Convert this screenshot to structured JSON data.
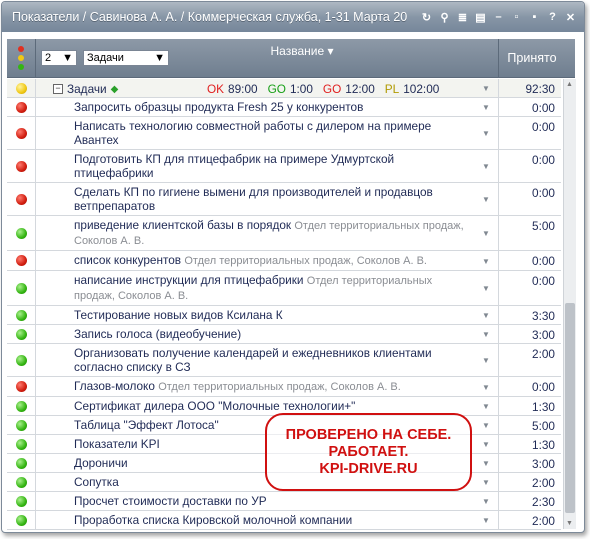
{
  "window": {
    "title": "Показатели / Савинова А. А. / Коммерческая служба, 1-31 Марта 20",
    "icons": [
      "refresh-icon",
      "search-icon",
      "list-icon",
      "export-icon",
      "minimize-icon",
      "restore-icon",
      "close-icon",
      "help-icon",
      "close-window-icon"
    ]
  },
  "header": {
    "level_value": "2",
    "view_value": "Задачи",
    "name_label": "Название",
    "accepted_label": "Принято"
  },
  "group": {
    "label": "Задачи",
    "ok_label": "OK",
    "ok_value": "89:00",
    "go1_label": "GO",
    "go1_value": "1:00",
    "go2_label": "GO",
    "go2_value": "12:00",
    "pl_label": "PL",
    "pl_value": "102:00",
    "accepted": "92:30"
  },
  "tasks": [
    {
      "status": "red",
      "name": "Запросить образцы продукта Fresh 25 у конкурентов",
      "dept": "",
      "value": "0:00"
    },
    {
      "status": "red",
      "name": "Написать технологию совместной работы с дилером на примере Авантех",
      "dept": "",
      "value": "0:00"
    },
    {
      "status": "red",
      "name": "Подготовить КП для птицефабрик на примере Удмуртской птицефабрики",
      "dept": "",
      "value": "0:00"
    },
    {
      "status": "red",
      "name": "Сделать КП по гигиене вымени для производителей и продавцов ветпрепаратов",
      "dept": "",
      "value": "0:00"
    },
    {
      "status": "green",
      "name": "приведение клиентской базы в порядок",
      "dept": "Отдел территориальных продаж, Соколов А. В.",
      "value": "5:00"
    },
    {
      "status": "red",
      "name": "список конкурентов",
      "dept": "Отдел территориальных продаж, Соколов А. В.",
      "value": "0:00"
    },
    {
      "status": "green",
      "name": "написание инструкции для птицефабрики",
      "dept": "Отдел территориальных продаж, Соколов А. В.",
      "value": "0:00"
    },
    {
      "status": "green",
      "name": "Тестирование новых видов Ксилана К",
      "dept": "",
      "value": "3:30"
    },
    {
      "status": "green",
      "name": "Запись голоса (видеобучение)",
      "dept": "",
      "value": "3:00"
    },
    {
      "status": "green",
      "name": "Организовать получение календарей и ежедневников клиентами согласно списку в СЗ",
      "dept": "",
      "value": "2:00"
    },
    {
      "status": "red",
      "name": "Глазов-молоко",
      "dept": "Отдел территориальных продаж, Соколов А. В.",
      "value": "0:00"
    },
    {
      "status": "green",
      "name": "Сертификат дилера ООО \"Молочные технологии+\"",
      "dept": "",
      "value": "1:30"
    },
    {
      "status": "green",
      "name": "Таблица \"Эффект Лотоса\"",
      "dept": "",
      "value": "5:00"
    },
    {
      "status": "green",
      "name": "Показатели KPI",
      "dept": "",
      "value": "1:30"
    },
    {
      "status": "green",
      "name": "Дороничи",
      "dept": "",
      "value": "3:00"
    },
    {
      "status": "green",
      "name": "Сопутка",
      "dept": "",
      "value": "2:00"
    },
    {
      "status": "green",
      "name": "Просчет стоимости доставки по УР",
      "dept": "",
      "value": "2:30"
    },
    {
      "status": "green",
      "name": "Проработка списка Кировской молочной компании",
      "dept": "",
      "value": "2:00"
    }
  ],
  "stamp": {
    "line1": "ПРОВЕРЕНО НА СЕБЕ.",
    "line2": "РАБОТАЕТ.",
    "line3": "KPI-DRIVE.RU"
  },
  "colors": {
    "ok": "#e02020",
    "go": "#18a018",
    "pl": "#c0a000",
    "red_status": "#d11e10",
    "green_status": "#34b512",
    "yellow_status": "#f0c814"
  }
}
